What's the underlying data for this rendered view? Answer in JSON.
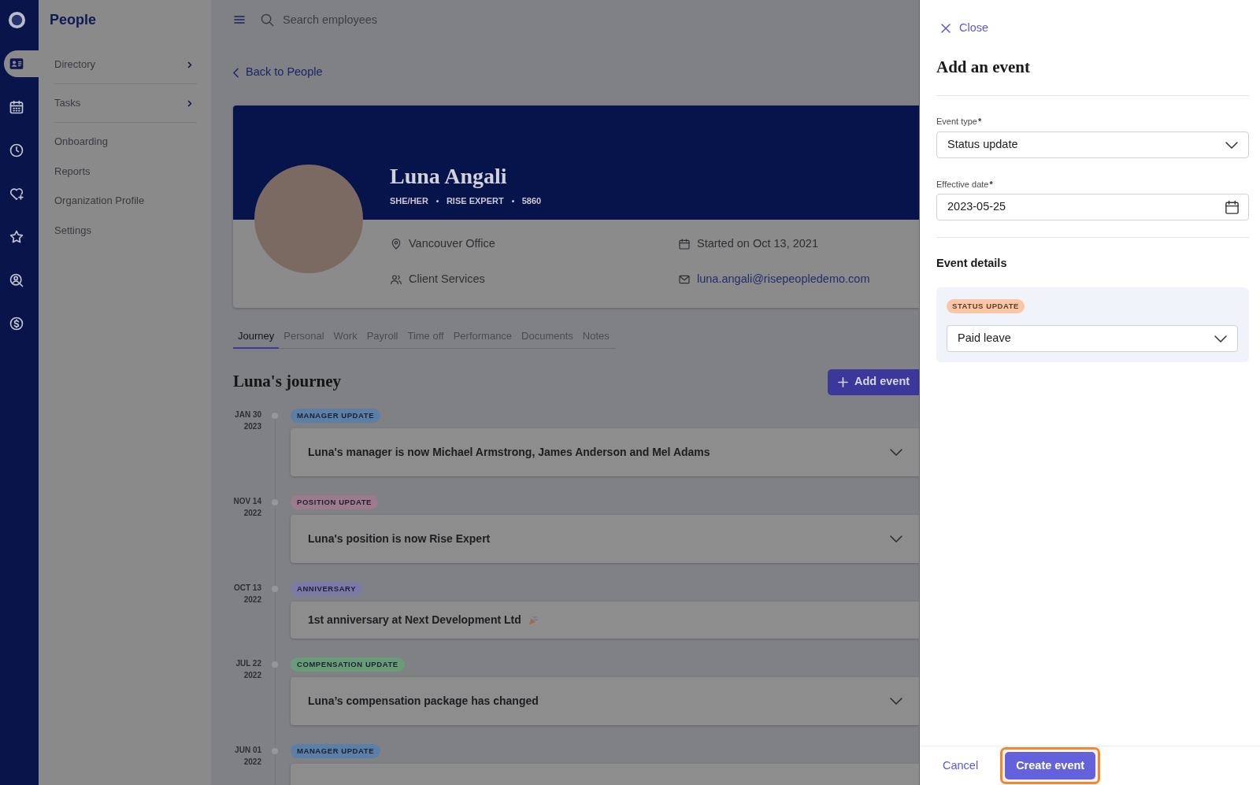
{
  "rail": {
    "items": [
      {
        "selected": true
      },
      {
        "selected": false
      },
      {
        "selected": false
      },
      {
        "selected": false
      },
      {
        "selected": false
      },
      {
        "selected": false
      },
      {
        "selected": false
      }
    ]
  },
  "sidebar": {
    "title": "People",
    "items": [
      {
        "label": "Directory",
        "kind": "submenu"
      },
      {
        "label": "Tasks",
        "kind": "submenu"
      },
      {
        "label": "Onboarding",
        "kind": "link"
      },
      {
        "label": "Reports",
        "kind": "link"
      },
      {
        "label": "Organization Profile",
        "kind": "link"
      },
      {
        "label": "Settings",
        "kind": "link"
      }
    ]
  },
  "top_bar": {
    "search": {
      "placeholder": "Search employees"
    }
  },
  "back_link": "Back to People",
  "profile": {
    "name": "Luna Angali",
    "meta": [
      "SHE/HER",
      "RISE EXPERT",
      "5860"
    ],
    "details": [
      {
        "kind": "location",
        "text": "Vancouver Office"
      },
      {
        "kind": "start_date",
        "text": "Started on Oct 13, 2021"
      },
      {
        "kind": "team",
        "text": "Client Services"
      },
      {
        "kind": "email",
        "text": "luna.angali@risepeopledemo.com"
      }
    ]
  },
  "tabs": [
    {
      "label": "Journey",
      "selected": true
    },
    {
      "label": "Personal",
      "selected": false
    },
    {
      "label": "Work",
      "selected": false
    },
    {
      "label": "Payroll",
      "selected": false
    },
    {
      "label": "Time off",
      "selected": false
    },
    {
      "label": "Performance",
      "selected": false
    },
    {
      "label": "Documents",
      "selected": false
    },
    {
      "label": "Notes",
      "selected": false
    }
  ],
  "journey": {
    "title": "Luna's journey",
    "add_button": "Add event",
    "events": [
      {
        "date": "JAN 30",
        "year": "2023",
        "tag": "MANAGER UPDATE",
        "color": "#5b7fa7",
        "kind": "expandable",
        "text": "Luna's manager is now Michael Armstrong, James Anderson and Mel Adams"
      },
      {
        "date": "NOV 14",
        "year": "2022",
        "tag": "POSITION UPDATE",
        "color": "#9c7b8f",
        "kind": "expandable",
        "text": "Luna's position is now Rise Expert"
      },
      {
        "date": "OCT 13",
        "year": "2022",
        "tag": "ANNIVERSARY",
        "color": "#7d79a8",
        "kind": "celebration",
        "text": "1st anniversary at Next Development Ltd"
      },
      {
        "date": "JUL 22",
        "year": "2022",
        "tag": "COMPENSATION UPDATE",
        "color": "#6b9c79",
        "kind": "expandable",
        "text": "Luna’s compensation package has changed"
      },
      {
        "date": "JUN 01",
        "year": "2022",
        "tag": "MANAGER UPDATE",
        "color": "#5b7fa7",
        "kind": "expandable"
      }
    ]
  },
  "panel": {
    "close": "Close",
    "title": "Add an event",
    "fields": [
      {
        "kind": "select",
        "label": "Event type",
        "required_mark": "*",
        "value": "Status update"
      },
      {
        "kind": "date",
        "label": "Effective date",
        "required_mark": "*",
        "value": "2023-05-25"
      }
    ],
    "details": {
      "title": "Event details",
      "tag": "STATUS UPDATE",
      "color": "#fbc6a5",
      "value": "Paid leave"
    },
    "footer": {
      "cancel": "Cancel",
      "submit": "Create event",
      "focused": true
    }
  }
}
